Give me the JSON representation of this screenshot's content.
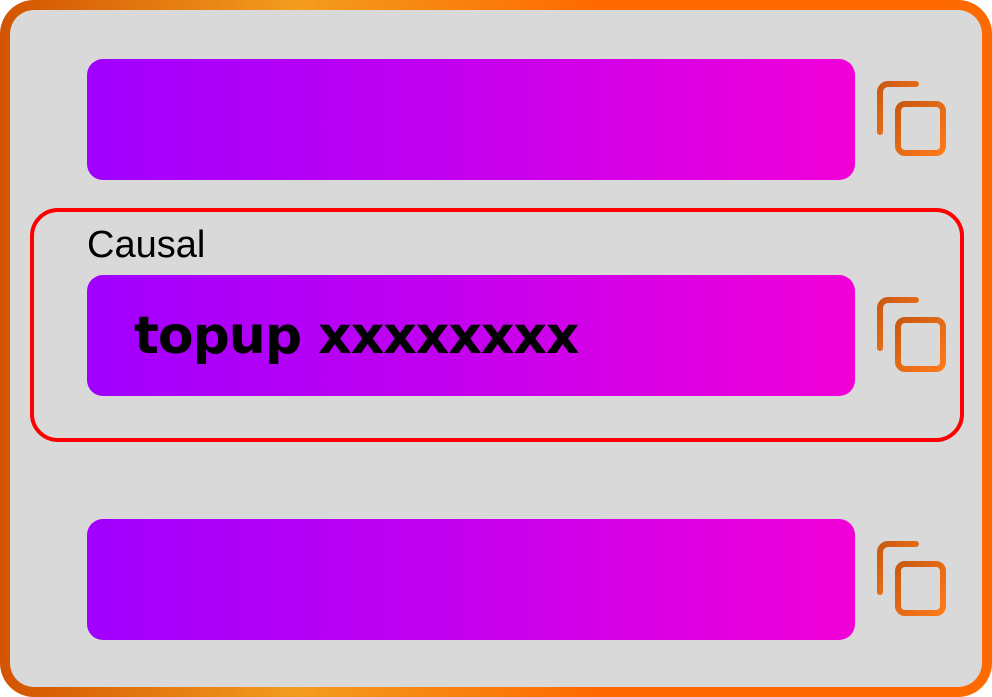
{
  "fields": [
    {
      "label": "",
      "value": "",
      "copy_icon": "copy-icon"
    },
    {
      "label": "Causal",
      "value": "topup xxxxxxxx",
      "copy_icon": "copy-icon"
    },
    {
      "label": "",
      "value": "",
      "copy_icon": "copy-icon"
    }
  ],
  "colors": {
    "frame_gradient": [
      "#d35400",
      "#f39c1f",
      "#ff6a00"
    ],
    "panel_background": "#d9d9d9",
    "field_gradient": [
      "#a100ff",
      "#c000f0",
      "#f200d8"
    ],
    "highlight_border": "#ff0000",
    "icon_gradient": [
      "#c95a12",
      "#ff7a1a"
    ]
  }
}
